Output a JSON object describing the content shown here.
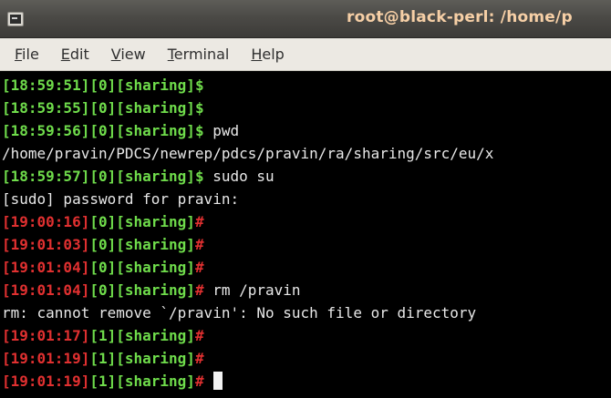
{
  "window": {
    "title": "root@black-perl: /home/p"
  },
  "menu": {
    "file": {
      "mnemonic": "F",
      "rest": "ile"
    },
    "edit": {
      "mnemonic": "E",
      "rest": "dit"
    },
    "view": {
      "mnemonic": "V",
      "rest": "iew"
    },
    "terminal": {
      "mnemonic": "T",
      "rest": "erminal"
    },
    "help": {
      "mnemonic": "H",
      "rest": "elp"
    }
  },
  "colors": {
    "prompt_user": "#6fdc4b",
    "prompt_root": "#e03030",
    "text": "#e8e8e8",
    "title": "#f6cfa6"
  },
  "terminal": {
    "lines": [
      {
        "time": "[18:59:51]",
        "status": "[0]",
        "dir": "[sharing]",
        "sym": "$",
        "cmd": ""
      },
      {
        "time": "[18:59:55]",
        "status": "[0]",
        "dir": "[sharing]",
        "sym": "$",
        "cmd": ""
      },
      {
        "time": "[18:59:56]",
        "status": "[0]",
        "dir": "[sharing]",
        "sym": "$",
        "cmd": " pwd"
      },
      {
        "text": "/home/pravin/PDCS/newrep/pdcs/pravin/ra/sharing/src/eu/x"
      },
      {
        "time": "[18:59:57]",
        "status": "[0]",
        "dir": "[sharing]",
        "sym": "$",
        "cmd": " sudo su"
      },
      {
        "text": "[sudo] password for pravin:"
      },
      {
        "time": "[19:00:16]",
        "status": "[0]",
        "dir": "[sharing]",
        "sym": "#",
        "cmd": ""
      },
      {
        "time": "[19:01:03]",
        "status": "[0]",
        "dir": "[sharing]",
        "sym": "#",
        "cmd": ""
      },
      {
        "time": "[19:01:04]",
        "status": "[0]",
        "dir": "[sharing]",
        "sym": "#",
        "cmd": ""
      },
      {
        "time": "[19:01:04]",
        "status": "[0]",
        "dir": "[sharing]",
        "sym": "#",
        "cmd": " rm /pravin"
      },
      {
        "text": "rm: cannot remove `/pravin': No such file or directory"
      },
      {
        "time": "[19:01:17]",
        "status": "[1]",
        "dir": "[sharing]",
        "sym": "#",
        "cmd": ""
      },
      {
        "time": "[19:01:19]",
        "status": "[1]",
        "dir": "[sharing]",
        "sym": "#",
        "cmd": ""
      },
      {
        "time": "[19:01:19]",
        "status": "[1]",
        "dir": "[sharing]",
        "sym": "#",
        "cmd": " "
      }
    ]
  }
}
